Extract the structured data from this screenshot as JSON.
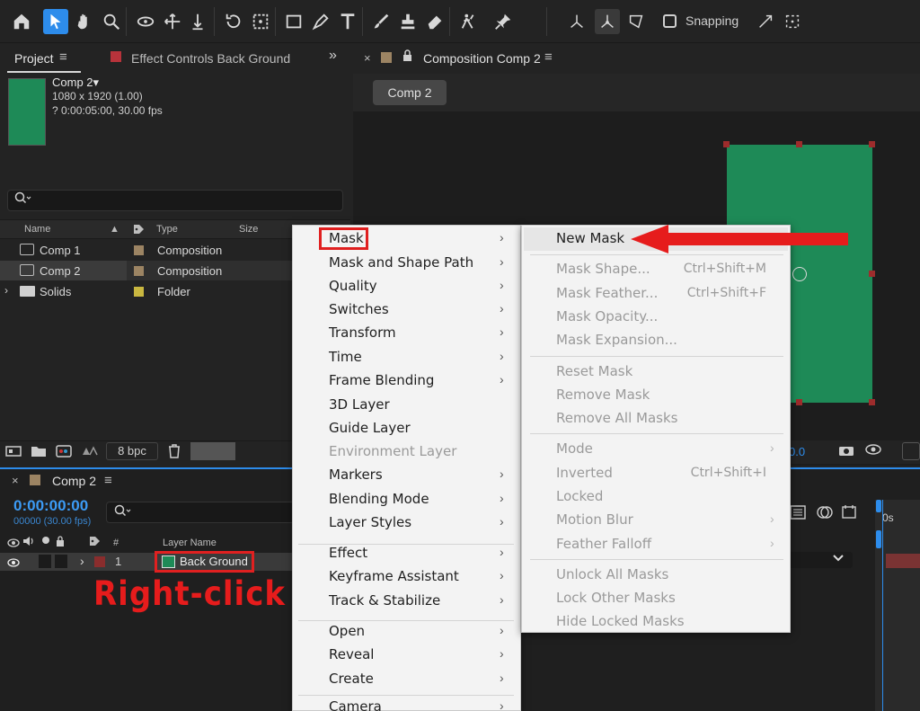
{
  "toolbar": {
    "snapping_label": "Snapping"
  },
  "project_panel": {
    "tab_label": "Project",
    "menu_icon": "≡",
    "effect_controls_tab": "Effect Controls Back Ground",
    "expand_icon": "»",
    "comp_name": "Comp 2▾",
    "comp_resolution": "1080 x 1920 (1.00)",
    "comp_duration": "? 0:00:05:00, 30.00 fps",
    "columns": {
      "name": "Name",
      "type": "Type",
      "size": "Size"
    },
    "items": [
      {
        "name": "Comp 1",
        "type": "Composition",
        "label_color": "#9c8463"
      },
      {
        "name": "Comp 2",
        "type": "Composition",
        "label_color": "#9c8463"
      },
      {
        "name": "Solids",
        "type": "Folder",
        "label_color": "#c9b740"
      }
    ],
    "bpc_label": "8 bpc"
  },
  "composition_panel": {
    "tab_title": "Composition Comp 2",
    "comp_pill": "Comp 2",
    "footer_value": "0.0",
    "solid_color": "#1e8a57"
  },
  "timeline": {
    "title": "Comp 2",
    "timecode": "0:00:00:00",
    "timecode_sub": "00000 (30.00 fps)",
    "layer_name_header": "Layer Name",
    "num_header": "#",
    "layer": {
      "num": "1",
      "name": "Back Ground"
    },
    "ruler_label": "0s",
    "annotation": "Right-click"
  },
  "context_menu": {
    "items": [
      {
        "label": "Mask",
        "submenu": true,
        "disabled": false
      },
      {
        "label": "Mask and Shape Path",
        "submenu": true,
        "disabled": false
      },
      {
        "label": "Quality",
        "submenu": true,
        "disabled": false
      },
      {
        "label": "Switches",
        "submenu": true,
        "disabled": false
      },
      {
        "label": "Transform",
        "submenu": true,
        "disabled": false
      },
      {
        "label": "Time",
        "submenu": true,
        "disabled": false
      },
      {
        "label": "Frame Blending",
        "submenu": true,
        "disabled": false
      },
      {
        "label": "3D Layer",
        "submenu": false,
        "disabled": false
      },
      {
        "label": "Guide Layer",
        "submenu": false,
        "disabled": false
      },
      {
        "label": "Environment Layer",
        "submenu": false,
        "disabled": true
      },
      {
        "label": "Markers",
        "submenu": true,
        "disabled": false
      },
      {
        "label": "Blending Mode",
        "submenu": true,
        "disabled": false
      },
      {
        "label": "Layer Styles",
        "submenu": true,
        "disabled": false
      },
      {
        "label": "Effect",
        "submenu": true,
        "disabled": false
      },
      {
        "label": "Keyframe Assistant",
        "submenu": true,
        "disabled": false
      },
      {
        "label": "Track & Stabilize",
        "submenu": true,
        "disabled": false
      },
      {
        "label": "Open",
        "submenu": true,
        "disabled": false
      },
      {
        "label": "Reveal",
        "submenu": true,
        "disabled": false
      },
      {
        "label": "Create",
        "submenu": true,
        "disabled": false
      },
      {
        "label": "Camera",
        "submenu": true,
        "disabled": false
      }
    ]
  },
  "mask_submenu": {
    "items": [
      {
        "label": "New Mask",
        "shortcut": "",
        "disabled": false,
        "submenu": false
      },
      {
        "label": "Mask Shape...",
        "shortcut": "Ctrl+Shift+M",
        "disabled": true,
        "submenu": false
      },
      {
        "label": "Mask Feather...",
        "shortcut": "Ctrl+Shift+F",
        "disabled": true,
        "submenu": false
      },
      {
        "label": "Mask Opacity...",
        "shortcut": "",
        "disabled": true,
        "submenu": false
      },
      {
        "label": "Mask Expansion...",
        "shortcut": "",
        "disabled": true,
        "submenu": false
      },
      {
        "label": "Reset Mask",
        "shortcut": "",
        "disabled": true,
        "submenu": false
      },
      {
        "label": "Remove Mask",
        "shortcut": "",
        "disabled": true,
        "submenu": false
      },
      {
        "label": "Remove All Masks",
        "shortcut": "",
        "disabled": true,
        "submenu": false
      },
      {
        "label": "Mode",
        "shortcut": "",
        "disabled": true,
        "submenu": true
      },
      {
        "label": "Inverted",
        "shortcut": "Ctrl+Shift+I",
        "disabled": true,
        "submenu": false
      },
      {
        "label": "Locked",
        "shortcut": "",
        "disabled": true,
        "submenu": false
      },
      {
        "label": "Motion Blur",
        "shortcut": "",
        "disabled": true,
        "submenu": true
      },
      {
        "label": "Feather Falloff",
        "shortcut": "",
        "disabled": true,
        "submenu": true
      },
      {
        "label": "Unlock All Masks",
        "shortcut": "",
        "disabled": true,
        "submenu": false
      },
      {
        "label": "Lock Other Masks",
        "shortcut": "",
        "disabled": true,
        "submenu": false
      },
      {
        "label": "Hide Locked Masks",
        "shortcut": "",
        "disabled": true,
        "submenu": false
      }
    ]
  },
  "accent_colors": {
    "selection_blue": "#2d8ceb",
    "annotation_red": "#e02020"
  }
}
